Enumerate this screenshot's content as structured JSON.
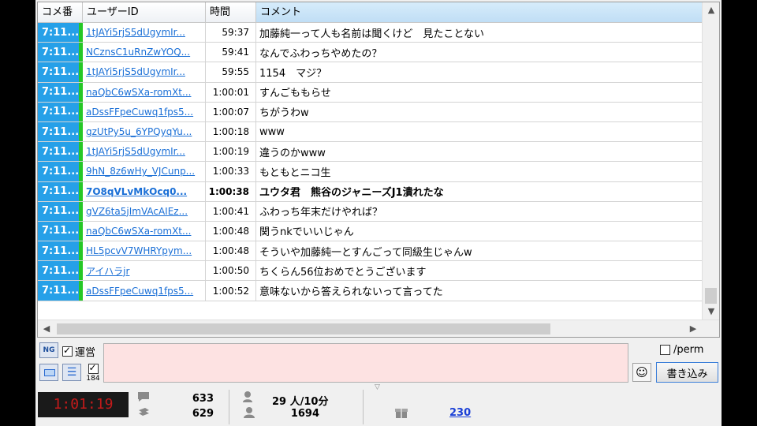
{
  "table": {
    "headers": {
      "no": "コメ番",
      "user_id": "ユーザーID",
      "time": "時間",
      "comment": "コメント"
    },
    "rows": [
      {
        "no": "7:11...",
        "user_id": "1tJAYi5rjS5dUgymIr...",
        "time": "59:37",
        "comment": "加藤純一って人も名前は聞くけど　見たことない",
        "bold": false
      },
      {
        "no": "7:11...",
        "user_id": "NCznsC1uRnZwYOQ...",
        "time": "59:41",
        "comment": "なんでふわっちやめたの？",
        "bold": false
      },
      {
        "no": "7:11...",
        "user_id": "1tJAYi5rjS5dUgymIr...",
        "time": "59:55",
        "comment": "1154　マジ？",
        "bold": false
      },
      {
        "no": "7:11...",
        "user_id": "naQbC6wSXa-romXt...",
        "time": "1:00:01",
        "comment": "すんごももらせ",
        "bold": false
      },
      {
        "no": "7:11...",
        "user_id": "aDssFFpeCuwq1fps5...",
        "time": "1:00:07",
        "comment": "ちがうわw",
        "bold": false
      },
      {
        "no": "7:11...",
        "user_id": "gzUtPy5u_6YPQyqYu...",
        "time": "1:00:18",
        "comment": "www",
        "bold": false
      },
      {
        "no": "7:11...",
        "user_id": "1tJAYi5rjS5dUgymIr...",
        "time": "1:00:19",
        "comment": "違うのかwww",
        "bold": false
      },
      {
        "no": "7:11...",
        "user_id": "9hN_8z6wHy_VJCunp...",
        "time": "1:00:33",
        "comment": "もともとニコ生",
        "bold": false
      },
      {
        "no": "7:11...",
        "user_id": "7O8qVLvMkOcq0...",
        "time": "1:00:38",
        "comment": "ユウタ君　熊谷のジャニーズJ1潰れたな",
        "bold": true
      },
      {
        "no": "7:11...",
        "user_id": "gVZ6ta5jImVAcAIEz...",
        "time": "1:00:41",
        "comment": "ふわっち年末だけやれば？",
        "bold": false
      },
      {
        "no": "7:11...",
        "user_id": "naQbC6wSXa-romXt...",
        "time": "1:00:48",
        "comment": "関うnkでいいじゃん",
        "bold": false
      },
      {
        "no": "7:11...",
        "user_id": "HL5pcvV7WHRYpym...",
        "time": "1:00:48",
        "comment": "そういや加藤純一とすんごって同級生じゃんw",
        "bold": false
      },
      {
        "no": "7:11...",
        "user_id": "アイハラjr",
        "time": "1:00:50",
        "comment": "ちくらん56位おめでとうございます",
        "bold": false
      },
      {
        "no": "7:11...",
        "user_id": "aDssFFpeCuwq1fps5...",
        "time": "1:00:52",
        "comment": "意味ないから答えられないって言ってた",
        "bold": false
      }
    ]
  },
  "input": {
    "ng_label": "NG",
    "unei_label": "運営",
    "anon_label": "184",
    "perm_label": "/perm",
    "write_label": "書き込み",
    "value": ""
  },
  "status": {
    "timer": "1:01:19",
    "comment_count": "633",
    "count2": "629",
    "viewers": "29 人/10分",
    "visitors": "1694",
    "gift_link": "230"
  },
  "icons": {
    "scroll_up": "▲",
    "scroll_down": "▼",
    "scroll_left": "◀",
    "scroll_right": "▶",
    "smile": "☺",
    "list": "☰"
  },
  "colors": {
    "no_cell_bg": "#26a0e8",
    "no_cell_accent": "#26c826",
    "link": "#1a6fd6",
    "input_bg": "#fde2e2",
    "timer_fg": "#c31a1a"
  }
}
